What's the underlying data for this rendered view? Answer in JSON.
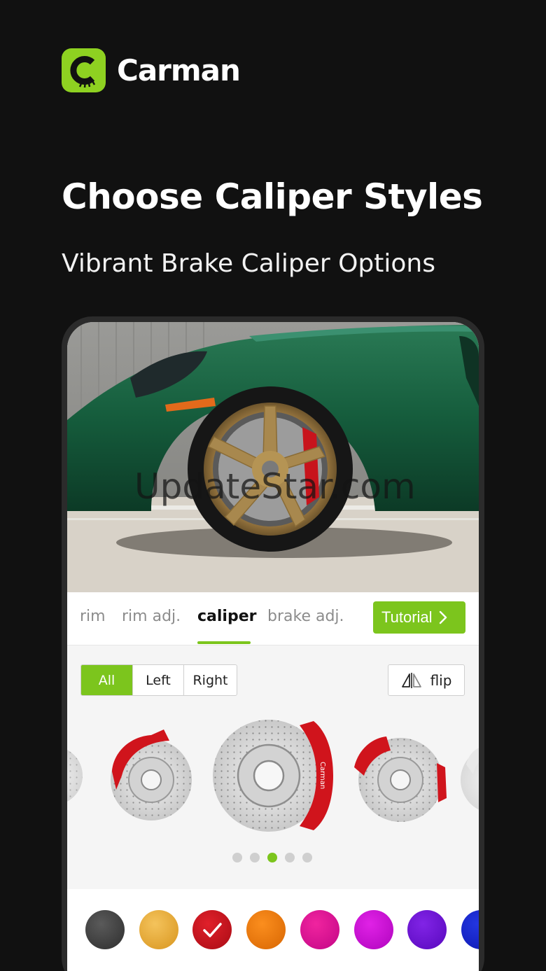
{
  "app": {
    "brand_name": "Carman",
    "accent_color": "#7cc51d"
  },
  "promo": {
    "headline": "Choose Caliper Styles",
    "subheadline": "Vibrant Brake Caliper Options"
  },
  "hero": {
    "watermark": "UpdateStar.com"
  },
  "tabs": [
    {
      "label": "rim",
      "active": false
    },
    {
      "label": "rim adj.",
      "active": false
    },
    {
      "label": "caliper",
      "active": true
    },
    {
      "label": "brake adj.",
      "active": false
    }
  ],
  "tutorial_button": {
    "label": "Tutorial",
    "icon": "chevron-right-icon"
  },
  "side_filter": {
    "options": [
      "All",
      "Left",
      "Right"
    ],
    "selected": "All"
  },
  "flip_button": {
    "label": "flip",
    "icon": "flip-horizontal-icon"
  },
  "caliper_carousel": {
    "items": [
      "caliper-style-1",
      "caliper-style-2",
      "caliper-style-3",
      "caliper-style-4",
      "caliper-style-5"
    ],
    "page_count": 5,
    "current_page": 3,
    "caliper_label": "Carman"
  },
  "colors": {
    "swatches": [
      "#3a3a3a",
      "#e6a531",
      "#c4111d",
      "#ec7a0a",
      "#df0d98",
      "#c80ad4",
      "#6a0fcf",
      "#1424c8"
    ],
    "selected_index": 2
  }
}
